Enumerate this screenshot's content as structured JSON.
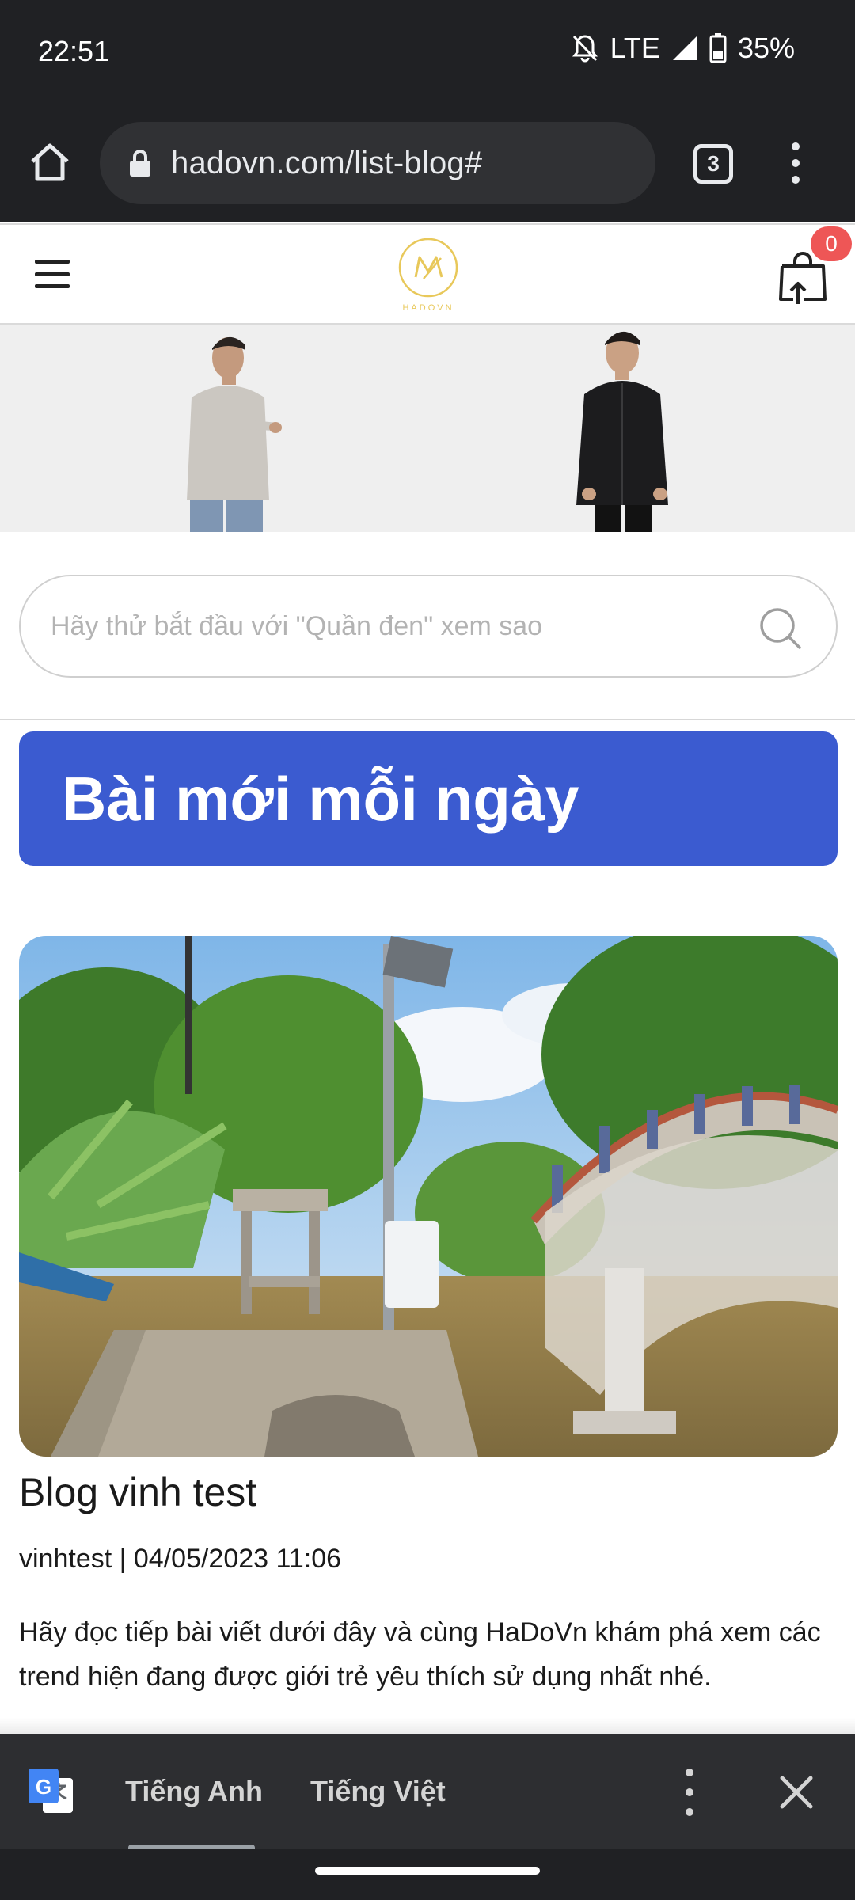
{
  "status_bar": {
    "time": "22:51",
    "network": "LTE",
    "battery": "35%",
    "icons": [
      "bell-off-icon",
      "signal-icon",
      "battery-icon"
    ]
  },
  "browser": {
    "url": "hadovn.com/list-blog#",
    "tab_count": "3",
    "icons": [
      "home-icon",
      "lock-icon",
      "more-vert-icon"
    ]
  },
  "site": {
    "brand_name": "HADOVN",
    "cart_count": "0",
    "accent_color": "#3b5bd0",
    "logo_color": "#e8c85a"
  },
  "search": {
    "placeholder": "Hãy thử bắt đầu với \"Quần đen\" xem sao"
  },
  "section": {
    "title": "Bài mới mỗi ngày"
  },
  "post": {
    "title": "Blog vinh test",
    "meta": "vinhtest | 04/05/2023 11:06",
    "excerpt": "Hãy đọc tiếp bài viết dưới đây và cùng HaDoVn khám phá xem các trend hiện đang được giới trẻ yêu thích sử dụng nhất nhé."
  },
  "translate_bar": {
    "languages": [
      "Tiếng Anh",
      "Tiếng Việt"
    ],
    "selected": "Tiếng Anh"
  }
}
